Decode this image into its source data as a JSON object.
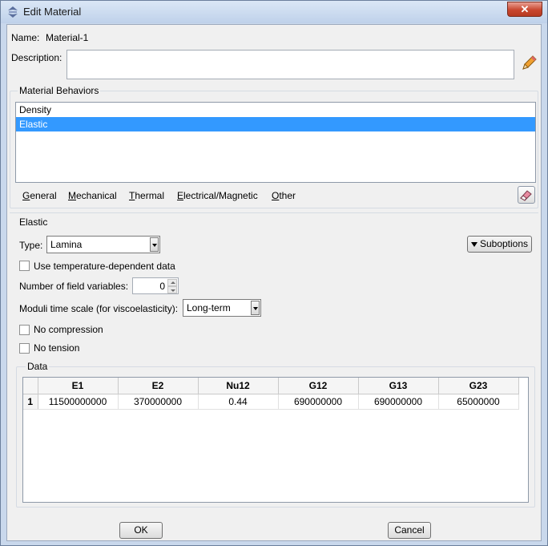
{
  "window": {
    "title": "Edit Material",
    "close_glyph": "✕"
  },
  "name": {
    "label": "Name:",
    "value": "Material-1"
  },
  "description": {
    "label": "Description:",
    "value": ""
  },
  "behaviors": {
    "title": "Material Behaviors",
    "items": [
      {
        "label": "Density",
        "selected": false
      },
      {
        "label": "Elastic",
        "selected": true
      }
    ],
    "menus": [
      {
        "underline": "G",
        "rest": "eneral"
      },
      {
        "underline": "M",
        "rest": "echanical"
      },
      {
        "underline": "T",
        "rest": "hermal"
      },
      {
        "underline": "E",
        "rest": "lectrical/Magnetic"
      },
      {
        "underline": "O",
        "rest": "ther"
      }
    ]
  },
  "elastic": {
    "title": "Elastic",
    "type_label": "Type:",
    "type_value": "Lamina",
    "suboptions_label": "Suboptions",
    "temp_dependent_label": "Use temperature-dependent data",
    "field_vars_label": "Number of field variables:",
    "field_vars_value": "0",
    "moduli_label": "Moduli time scale (for viscoelasticity):",
    "moduli_value": "Long-term",
    "no_compression_label": "No compression",
    "no_tension_label": "No tension"
  },
  "data_table": {
    "title": "Data",
    "columns": [
      "E1",
      "E2",
      "Nu12",
      "G12",
      "G13",
      "G23"
    ],
    "rows": [
      {
        "num": "1",
        "cells": [
          "11500000000",
          "370000000",
          "0.44",
          "690000000",
          "690000000",
          "65000000"
        ]
      }
    ]
  },
  "buttons": {
    "ok": "OK",
    "cancel": "Cancel"
  },
  "colors": {
    "selection": "#3399ff",
    "close_button": "#c8472f"
  }
}
